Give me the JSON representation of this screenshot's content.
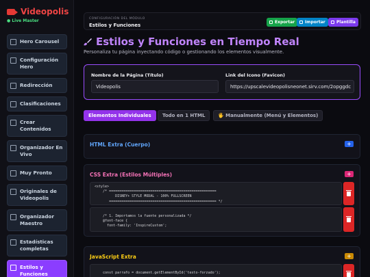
{
  "sidebar": {
    "brand": "Videopolis",
    "live": "● Live Master",
    "items": [
      {
        "label": "Hero Carousel",
        "icon": "gallery-icon"
      },
      {
        "label": "Configuración Hero",
        "icon": "list-icon"
      },
      {
        "label": "Redirección",
        "icon": "sliders-icon"
      },
      {
        "label": "Clasificaciones",
        "icon": "list-icon"
      },
      {
        "label": "Crear Contenidos",
        "icon": "calendar-icon"
      },
      {
        "label": "Organizador En Vivo",
        "icon": "broadcast-icon"
      },
      {
        "label": "Muy Pronto",
        "icon": "film-icon"
      },
      {
        "label": "Originales de Videopolis",
        "icon": "star-icon"
      },
      {
        "label": "Organizador Maestro",
        "icon": "move-icon"
      },
      {
        "label": "Estadísticas completas",
        "icon": "chart-icon"
      },
      {
        "label": "Estilos y Funciones",
        "icon": "brush-icon",
        "active": true
      }
    ]
  },
  "topbar": {
    "caption": "CONFIGURACIÓN DEL MÓDULO",
    "title": "Estilos y Funciones",
    "export": "Exportar",
    "import": "Importar",
    "template": "Plantilla"
  },
  "main": {
    "title": "Estilos y Funciones en Tiempo Real",
    "subtitle": "Personaliza tu página inyectando código o gestionando los elementos visualmente.",
    "page_name_label": "Nombre de la Página (Título)",
    "page_name_value": "Videopolis",
    "favicon_label": "Link del Icono (Favicon)",
    "favicon_value": "https://upscalevideopolisneonet.sirv.com/2opggdc",
    "tabs": [
      "Elementos Individuales",
      "Todo en 1 HTML",
      "🖐 Manualmente (Menú y Elementos)"
    ],
    "sections": {
      "html": {
        "title": "HTML Extra (Cuerpo)"
      },
      "css": {
        "title": "CSS Extra (Estilos Múltiples)",
        "code1": "<style>\n    /* ====================================================\n          DISNEY+ STYLE MODAL - 100% FULLSCREEN\n       ==================================================== */",
        "code2": "    /* 1. Importamos la fuente personalizada */\n    @font-face {\n      font-family: 'InspireCustom';"
      },
      "js": {
        "title": "JavaScript Extra",
        "code1": "    const parrafo = document.getElementById('texto-forzado');"
      }
    }
  },
  "colors": {
    "accent": "#9333ea",
    "html_title": "#60a5fa",
    "css_title": "#f472b6",
    "js_title": "#facc15"
  }
}
